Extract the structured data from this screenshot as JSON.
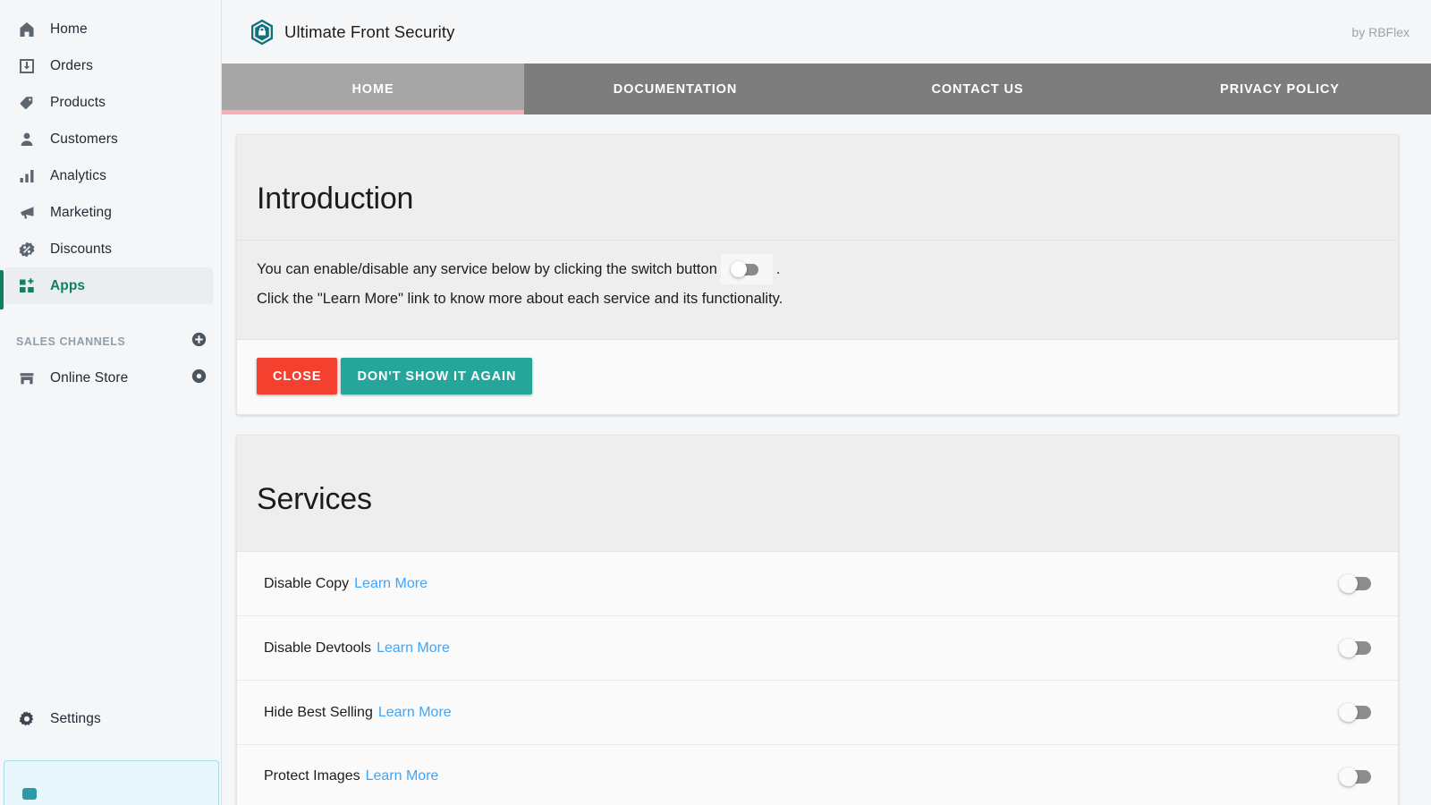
{
  "sidebar": {
    "items": [
      {
        "label": "Home",
        "icon": "home-icon"
      },
      {
        "label": "Orders",
        "icon": "orders-inbox-icon"
      },
      {
        "label": "Products",
        "icon": "tag-icon"
      },
      {
        "label": "Customers",
        "icon": "person-icon"
      },
      {
        "label": "Analytics",
        "icon": "bar-chart-icon"
      },
      {
        "label": "Marketing",
        "icon": "megaphone-icon"
      },
      {
        "label": "Discounts",
        "icon": "percent-badge-icon"
      },
      {
        "label": "Apps",
        "icon": "apps-grid-plus-icon"
      }
    ],
    "sales_channels": {
      "title": "SALES CHANNELS",
      "add_icon": "plus-circle-icon",
      "items": [
        {
          "label": "Online Store",
          "icon": "storefront-icon",
          "action_icon": "view-eye-icon"
        }
      ]
    },
    "settings": {
      "label": "Settings",
      "icon": "gear-icon"
    },
    "active_item": "Apps",
    "accent_color": "#108060"
  },
  "appbar": {
    "app_title": "Ultimate Front Security",
    "logo_icon": "hexagon-shield-logo",
    "by_line": "by RBFlex"
  },
  "tabs": [
    {
      "label": "HOME",
      "active": true
    },
    {
      "label": "DOCUMENTATION",
      "active": false
    },
    {
      "label": "CONTACT US",
      "active": false
    },
    {
      "label": "PRIVACY POLICY",
      "active": false
    }
  ],
  "tab_colors": {
    "bar": "#7d7d7d",
    "active_bg": "#a6a6a6",
    "active_underline": "#f7aeb6"
  },
  "introduction": {
    "title": "Introduction",
    "line1_before": "You can enable/disable any service below by clicking the switch button",
    "switch_icon": "toggle-switch-icon",
    "line1_after": ".",
    "line2": "Click the \"Learn More\" link to know more about each service and its functionality.",
    "buttons": {
      "close": {
        "label": "CLOSE",
        "color": "#f4402e"
      },
      "dont_show": {
        "label": "DON'T SHOW IT AGAIN",
        "color": "#26a69a"
      }
    }
  },
  "services": {
    "title": "Services",
    "link_label": "Learn More",
    "link_color": "#42a5f5",
    "rows": [
      {
        "name": "Disable Copy",
        "link": "Learn More",
        "enabled": false
      },
      {
        "name": "Disable Devtools",
        "link": "Learn More",
        "enabled": false
      },
      {
        "name": "Hide Best Selling",
        "link": "Learn More",
        "enabled": false
      },
      {
        "name": "Protect Images",
        "link": "Learn More",
        "enabled": false
      }
    ]
  }
}
